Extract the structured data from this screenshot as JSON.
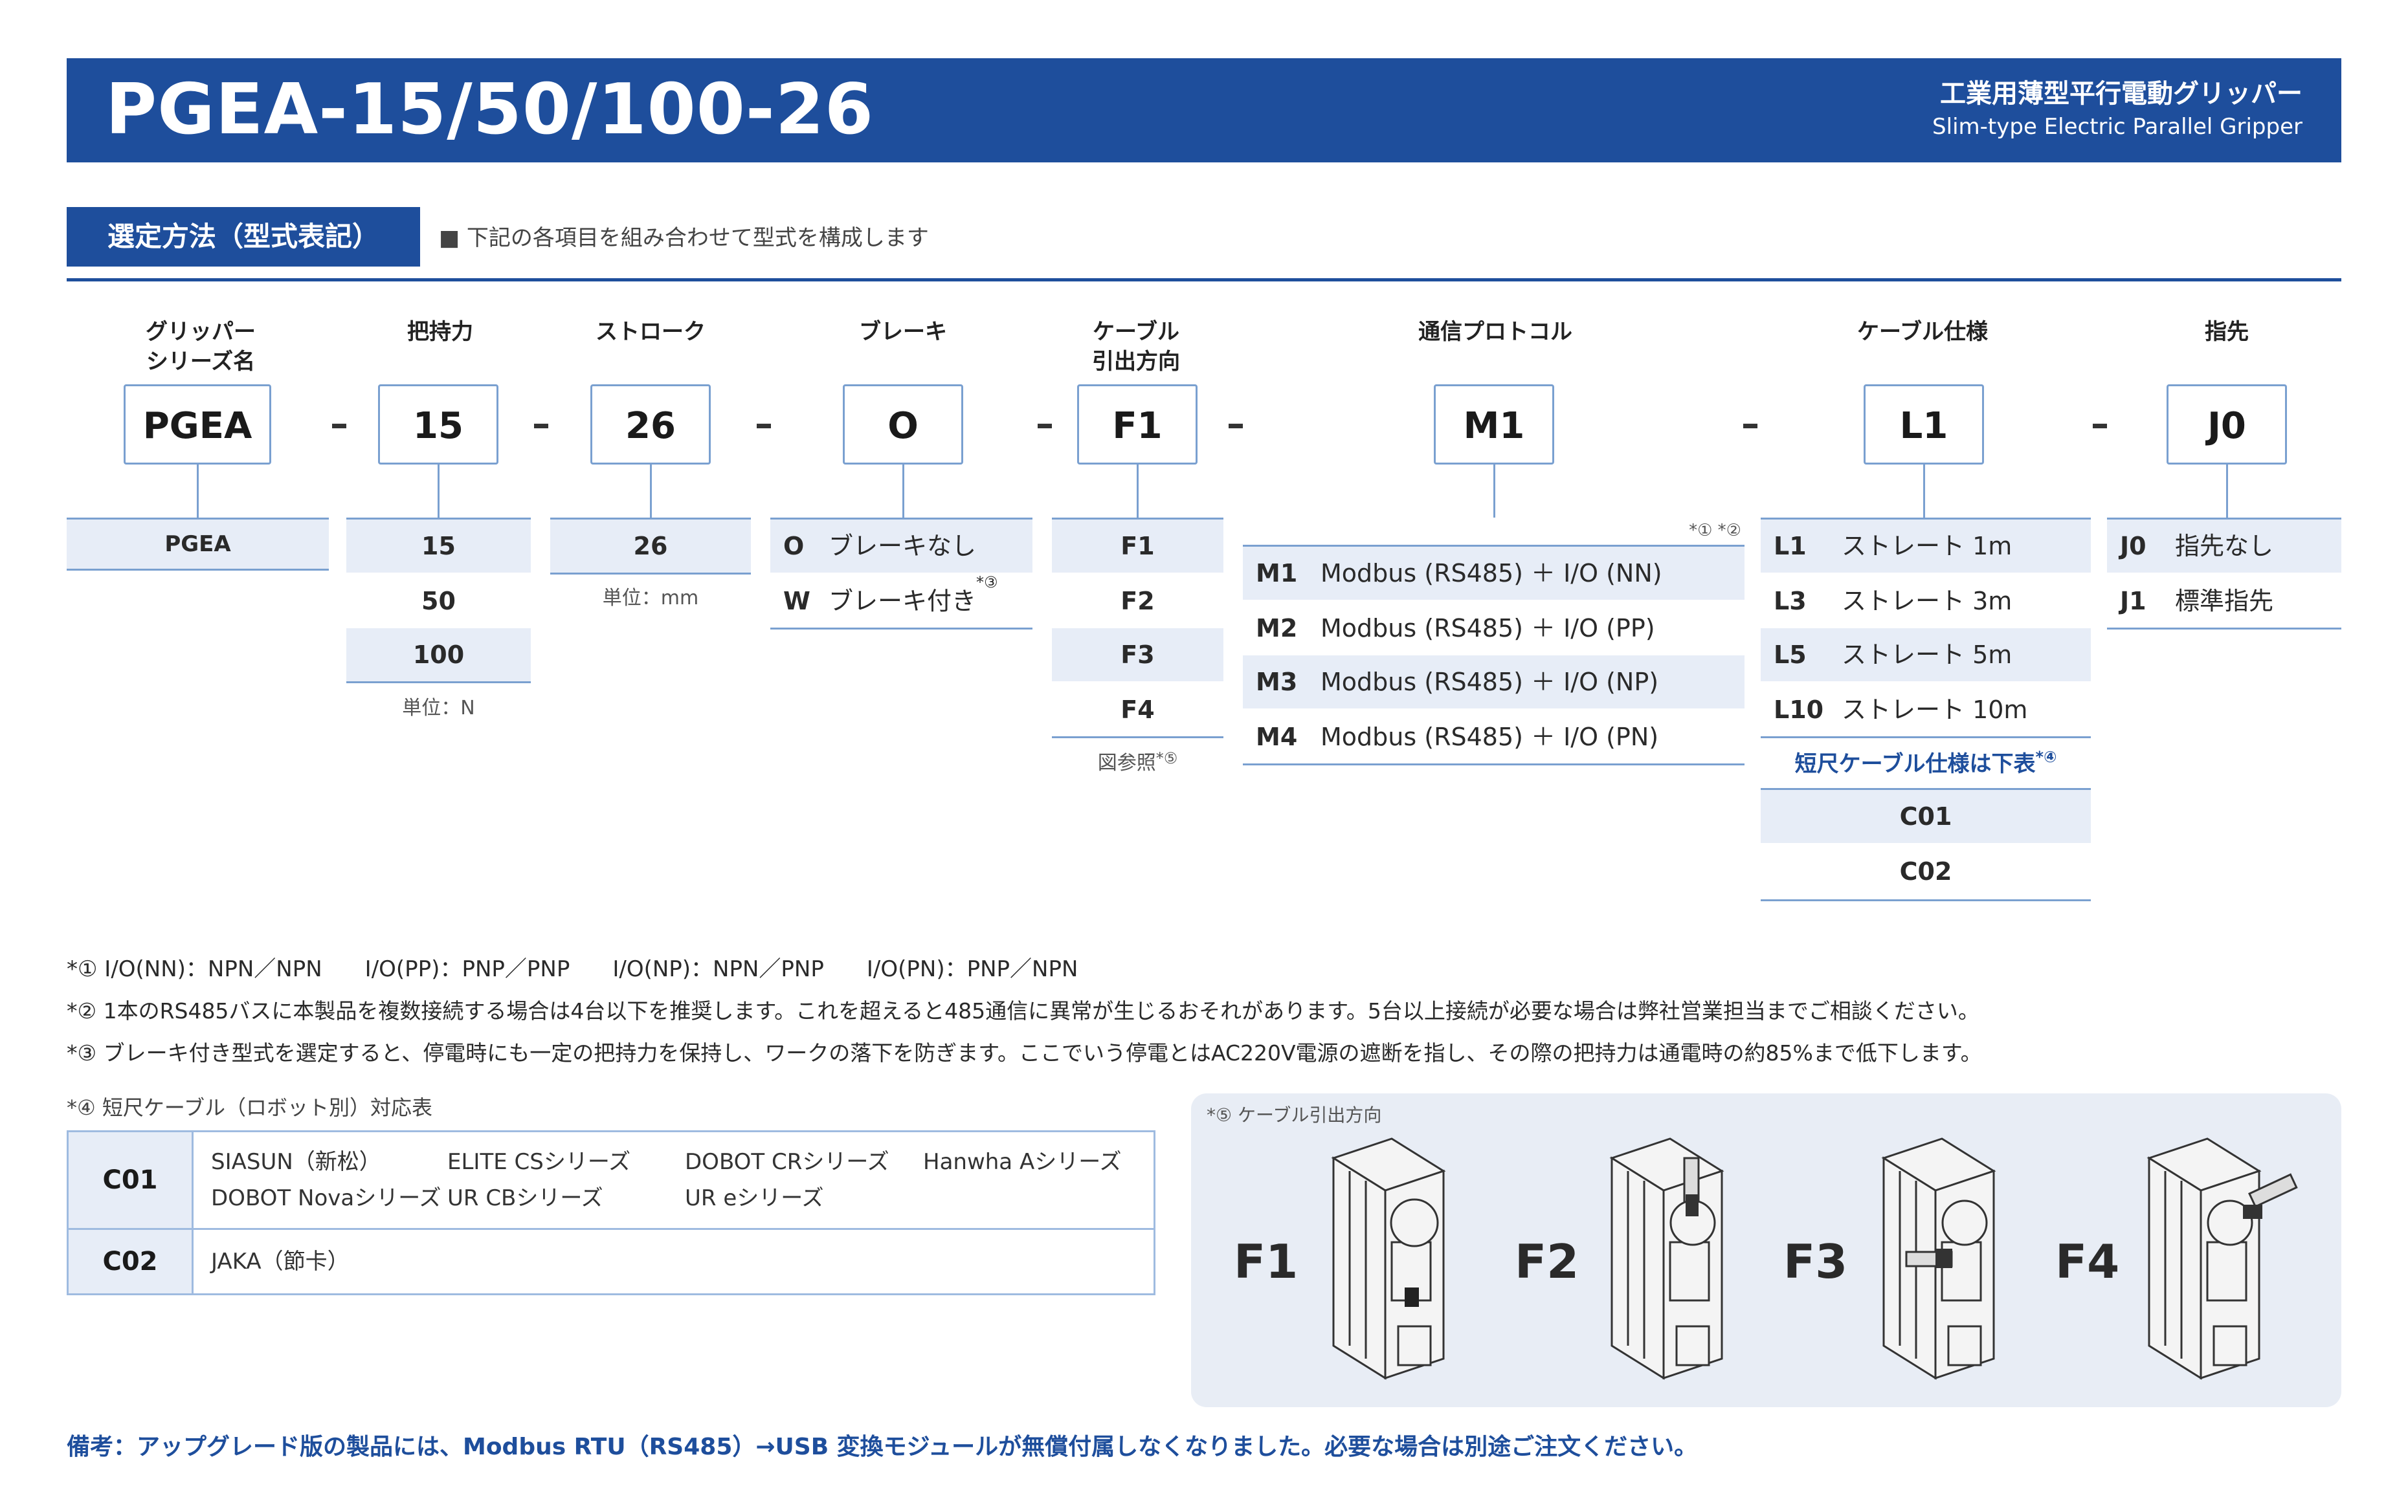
{
  "header": {
    "title": "PGEA-15/50/100-26",
    "subtitle_jp": "工業用薄型平行電動グリッパー",
    "subtitle_en": "Slim-type Electric Parallel Gripper"
  },
  "section": {
    "title": "選定方法（型式表記）",
    "note": "■ 下記の各項目を組み合わせて型式を構成します"
  },
  "columns": {
    "series": {
      "head1": "グリッパー",
      "head2": "シリーズ名",
      "code": "PGEA",
      "options": [
        "PGEA"
      ]
    },
    "force": {
      "head": "把持力",
      "code": "15",
      "options": [
        "15",
        "50",
        "100"
      ],
      "unit": "単位：N"
    },
    "stroke": {
      "head": "ストローク",
      "code": "26",
      "options": [
        "26"
      ],
      "unit": "単位：mm"
    },
    "brake": {
      "head": "ブレーキ",
      "code": "O",
      "options": [
        {
          "key": "O",
          "label": "ブレーキなし",
          "note": ""
        },
        {
          "key": "W",
          "label": "ブレーキ付き",
          "note": "*③"
        }
      ]
    },
    "cable_dir": {
      "head1": "ケーブル",
      "head2": "引出方向",
      "code": "F1",
      "options": [
        "F1",
        "F2",
        "F3",
        "F4"
      ],
      "unit": "図参照",
      "unit_note": "*⑤"
    },
    "protocol": {
      "head": "通信プロトコル",
      "code": "M1",
      "note": "*① *②",
      "options": [
        {
          "key": "M1",
          "label": "Modbus (RS485) ＋ I/O (NN)"
        },
        {
          "key": "M2",
          "label": "Modbus (RS485) ＋ I/O (PP)"
        },
        {
          "key": "M3",
          "label": "Modbus (RS485) ＋ I/O (NP)"
        },
        {
          "key": "M4",
          "label": "Modbus (RS485) ＋ I/O (PN)"
        }
      ]
    },
    "cable_spec": {
      "head": "ケーブル仕様",
      "code": "L1",
      "options": [
        {
          "key": "L1",
          "label": "ストレート 1m"
        },
        {
          "key": "L3",
          "label": "ストレート 3m"
        },
        {
          "key": "L5",
          "label": "ストレート 5m"
        },
        {
          "key": "L10",
          "label": "ストレート 10m"
        }
      ],
      "short_title": "短尺ケーブル仕様は下表",
      "short_note": "*④",
      "short_options": [
        "C01",
        "C02"
      ]
    },
    "finger": {
      "head": "指先",
      "code": "J0",
      "options": [
        {
          "key": "J0",
          "label": "指先なし"
        },
        {
          "key": "J1",
          "label": "標準指先"
        }
      ]
    }
  },
  "dash": "–",
  "footnotes": {
    "n1_mark": "*① I/O(NN)：NPN／NPN",
    "n1_pp": "I/O(PP)：PNP／PNP",
    "n1_np": "I/O(NP)：NPN／PNP",
    "n1_pn": "I/O(PN)：PNP／NPN",
    "n2": "*② 1本のRS485バスに本製品を複数接続する場合は4台以下を推奨します。これを超えると485通信に異常が生じるおそれがあります。5台以上接続が必要な場合は弊社営業担当までご相談ください。",
    "n3": "*③ ブレーキ付き型式を選定すると、停電時にも一定の把持力を保持し、ワークの落下を防ぎます。ここでいう停電とはAC220V電源の遮断を指し、その際の把持力は通電時の約85%まで低下します。"
  },
  "cable_table": {
    "title": "*④ 短尺ケーブル（ロボット別）対応表",
    "rows": [
      {
        "key": "C01",
        "items": [
          "SIASUN（新松）",
          "ELITE CSシリーズ",
          "DOBOT CRシリーズ",
          "Hanwha Aシリーズ",
          "DOBOT Novaシリーズ",
          "UR CBシリーズ",
          "UR eシリーズ"
        ]
      },
      {
        "key": "C02",
        "items": [
          "JAKA（節卡）"
        ]
      }
    ]
  },
  "figure": {
    "caption": "*⑤ ケーブル引出方向",
    "labels": [
      "F1",
      "F2",
      "F3",
      "F4"
    ]
  },
  "remark": "備考：アップグレード版の製品には、Modbus RTU（RS485）→USB 変換モジュールが無償付属しなくなりました。必要な場合は別途ご注文ください。"
}
